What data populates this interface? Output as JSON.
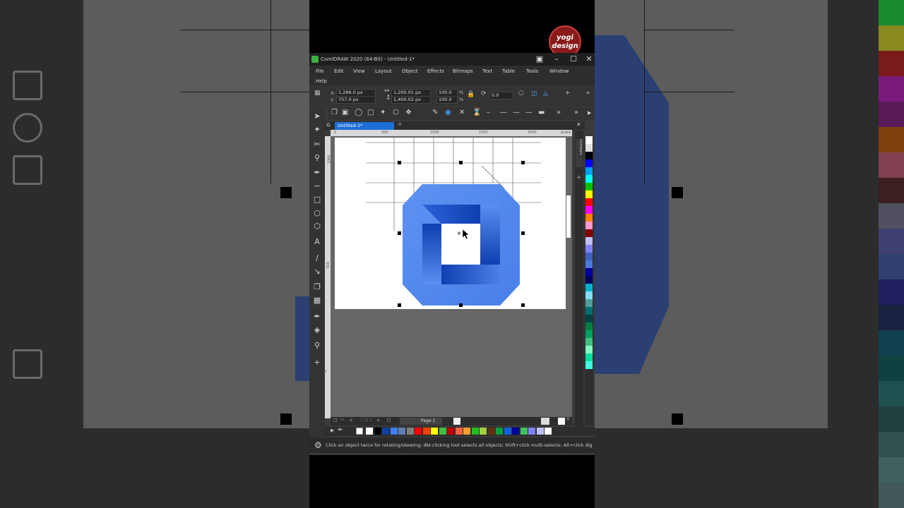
{
  "app": {
    "title": "CorelDRAW 2020 (64-Bit) - Untitled-1*",
    "minimize": "–",
    "maximize": "☐",
    "close": "✕"
  },
  "watermark": {
    "text": "yogi design"
  },
  "menu": {
    "items": [
      {
        "label": "File"
      },
      {
        "label": "Edit"
      },
      {
        "label": "View"
      },
      {
        "label": "Layout"
      },
      {
        "label": "Object"
      },
      {
        "label": "Effects"
      },
      {
        "label": "Bitmaps"
      },
      {
        "label": "Text"
      },
      {
        "label": "Table"
      },
      {
        "label": "Tools"
      },
      {
        "label": "Window"
      },
      {
        "label": "Help"
      }
    ]
  },
  "property_bar": {
    "x_label": "X:",
    "x_value": "1,286.0 px",
    "y_label": "Y:",
    "y_value": "757.0 px",
    "width_value": "1,200.01 px",
    "height_value": "1,400.02 px",
    "scale_x": "100.0",
    "scale_y": "100.0",
    "percent": "%",
    "rotation": "0.0"
  },
  "document": {
    "tab_label": "Untitled-1*",
    "page_label": "Page 1"
  },
  "ruler": {
    "h_ticks": [
      "0",
      "500",
      "1000",
      "1500",
      "2000",
      "pixels"
    ],
    "v_ticks": [
      "1000",
      "500",
      "0"
    ]
  },
  "dock": {
    "tab_label": "Contours"
  },
  "status": {
    "message": "Click an object twice for rotating/skewing; dbl-clicking tool selects all objects; Shift+click multi-selects; Alt+click digs; C"
  },
  "colors": {
    "shape_light": "#5b8ef0",
    "shape_dark": "#1a4fc4",
    "accent_tab": "#1d6fd6",
    "background": "#000000"
  },
  "palette_right": [
    "#ffffff",
    "#e0e0e0",
    "#000000",
    "#0000ff",
    "#00a0ff",
    "#00ffff",
    "#00c000",
    "#ffff00",
    "#ff0000",
    "#ff00ff",
    "#ff8000",
    "#ff99cc",
    "#800000",
    "#c0c0ff",
    "#8080ff",
    "#4060c0",
    "#4c78e0",
    "#0000a0",
    "#000060",
    "#00b0d0",
    "#80e0ff",
    "#50a0a0",
    "#007070",
    "#004040",
    "#008040",
    "#00a060",
    "#40c080",
    "#80ffc0",
    "#00e0a0",
    "#40ffe0"
  ],
  "palette_bottom": [
    "#ffffff",
    "#000000",
    "#1040a0",
    "#4080f0",
    "#6080b0",
    "#808080",
    "#ff0000",
    "#ff4000",
    "#ffff00",
    "#40c040",
    "#c00000",
    "#ff6040",
    "#ffa030",
    "#20c020",
    "#a0d040",
    "#603010",
    "#00a040",
    "#1060e0",
    "#0000a0",
    "#40c060",
    "#8080ff",
    "#c0c0ff",
    "#ffffff"
  ],
  "icons": [
    "select-tool-icon",
    "shape-tool-icon",
    "crop-tool-icon",
    "zoom-tool-icon",
    "freehand-tool-icon",
    "artistic-media-icon",
    "rectangle-tool-icon",
    "ellipse-tool-icon",
    "polygon-tool-icon",
    "text-tool-icon",
    "parallel-dimension-icon",
    "connector-tool-icon",
    "drop-shadow-icon",
    "transparency-icon",
    "eyedropper-icon",
    "interactive-fill-icon",
    "smart-fill-icon",
    "add-tool-icon"
  ]
}
